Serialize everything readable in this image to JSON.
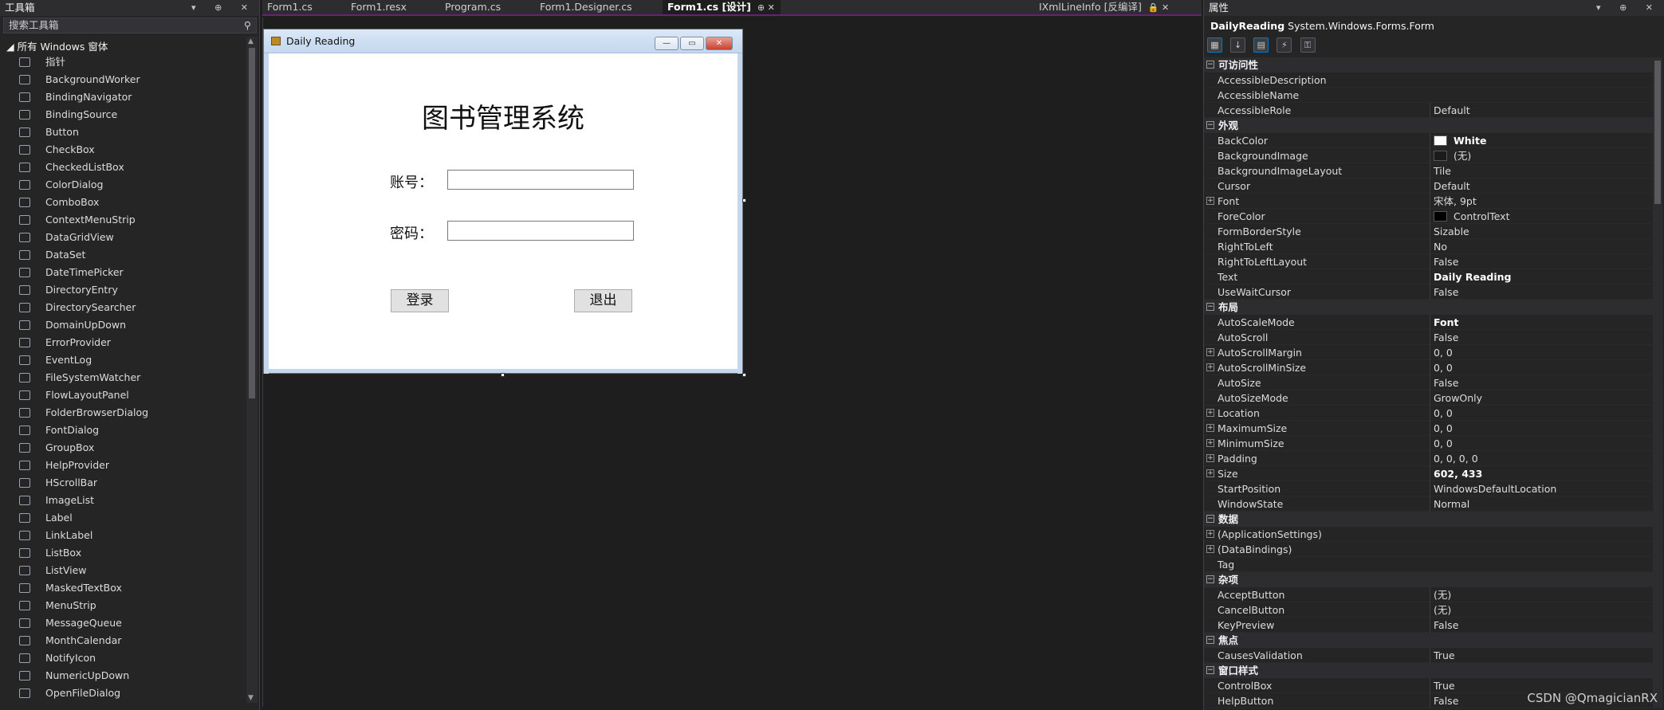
{
  "toolbox": {
    "title": "工具箱",
    "title_actions": "▾ ⊕ ✕",
    "search_placeholder": "搜索工具箱",
    "search_icon": "search-icon",
    "group_label": "◢ 所有 Windows 窗体",
    "items": [
      "指针",
      "BackgroundWorker",
      "BindingNavigator",
      "BindingSource",
      "Button",
      "CheckBox",
      "CheckedListBox",
      "ColorDialog",
      "ComboBox",
      "ContextMenuStrip",
      "DataGridView",
      "DataSet",
      "DateTimePicker",
      "DirectoryEntry",
      "DirectorySearcher",
      "DomainUpDown",
      "ErrorProvider",
      "EventLog",
      "FileSystemWatcher",
      "FlowLayoutPanel",
      "FolderBrowserDialog",
      "FontDialog",
      "GroupBox",
      "HelpProvider",
      "HScrollBar",
      "ImageList",
      "Label",
      "LinkLabel",
      "ListBox",
      "ListView",
      "MaskedTextBox",
      "MenuStrip",
      "MessageQueue",
      "MonthCalendar",
      "NotifyIcon",
      "NumericUpDown",
      "OpenFileDialog"
    ]
  },
  "tabs": [
    {
      "label": "Form1.cs",
      "active": false
    },
    {
      "label": "Form1.resx",
      "active": false
    },
    {
      "label": "Program.cs",
      "active": false
    },
    {
      "label": "Form1.Designer.cs",
      "active": false
    },
    {
      "label": "Form1.cs [设计]",
      "active": true,
      "suffix": "⊕ ✕"
    },
    {
      "label": "IXmlLineInfo [反编译]",
      "active": false,
      "suffix": "🔒 ✕"
    }
  ],
  "tabbar_actions": "▾ ⚙",
  "form": {
    "window_title": "Daily Reading",
    "system_title": "图书管理系统",
    "account_label": "账号：",
    "password_label": "密码：",
    "login_button": "登录",
    "exit_button": "退出",
    "minimize_glyph": "—",
    "maximize_glyph": "▭",
    "close_glyph": "✕"
  },
  "properties": {
    "title": "属性",
    "title_actions": "▾ ⊕ ✕",
    "object_name": "DailyReading",
    "object_type": "System.Windows.Forms.Form",
    "toolbar_icons": [
      "categorized-icon",
      "alphabetical-icon",
      "properties-icon",
      "events-icon",
      "property-pages-icon"
    ],
    "categories": [
      {
        "name": "可访问性",
        "rows": [
          {
            "name": "AccessibleDescription",
            "value": ""
          },
          {
            "name": "AccessibleName",
            "value": ""
          },
          {
            "name": "AccessibleRole",
            "value": "Default"
          }
        ]
      },
      {
        "name": "外观",
        "rows": [
          {
            "name": "BackColor",
            "value": "White",
            "swatch": "#ffffff",
            "bold": true
          },
          {
            "name": "BackgroundImage",
            "value": "(无)",
            "swatch": "#1b1b1b"
          },
          {
            "name": "BackgroundImageLayout",
            "value": "Tile"
          },
          {
            "name": "Cursor",
            "value": "Default"
          },
          {
            "name": "Font",
            "value": "宋体, 9pt",
            "expand": true
          },
          {
            "name": "ForeColor",
            "value": "ControlText",
            "swatch": "#000000"
          },
          {
            "name": "FormBorderStyle",
            "value": "Sizable"
          },
          {
            "name": "RightToLeft",
            "value": "No"
          },
          {
            "name": "RightToLeftLayout",
            "value": "False"
          },
          {
            "name": "Text",
            "value": "Daily Reading",
            "bold": true
          },
          {
            "name": "UseWaitCursor",
            "value": "False"
          }
        ]
      },
      {
        "name": "布局",
        "rows": [
          {
            "name": "AutoScaleMode",
            "value": "Font",
            "bold": true
          },
          {
            "name": "AutoScroll",
            "value": "False"
          },
          {
            "name": "AutoScrollMargin",
            "value": "0, 0",
            "expand": true
          },
          {
            "name": "AutoScrollMinSize",
            "value": "0, 0",
            "expand": true
          },
          {
            "name": "AutoSize",
            "value": "False"
          },
          {
            "name": "AutoSizeMode",
            "value": "GrowOnly"
          },
          {
            "name": "Location",
            "value": "0, 0",
            "expand": true
          },
          {
            "name": "MaximumSize",
            "value": "0, 0",
            "expand": true
          },
          {
            "name": "MinimumSize",
            "value": "0, 0",
            "expand": true
          },
          {
            "name": "Padding",
            "value": "0, 0, 0, 0",
            "expand": true
          },
          {
            "name": "Size",
            "value": "602, 433",
            "expand": true,
            "bold": true
          },
          {
            "name": "StartPosition",
            "value": "WindowsDefaultLocation"
          },
          {
            "name": "WindowState",
            "value": "Normal"
          }
        ]
      },
      {
        "name": "数据",
        "rows": [
          {
            "name": "(ApplicationSettings)",
            "value": "",
            "expand": true
          },
          {
            "name": "(DataBindings)",
            "value": "",
            "expand": true
          },
          {
            "name": "Tag",
            "value": ""
          }
        ]
      },
      {
        "name": "杂项",
        "rows": [
          {
            "name": "AcceptButton",
            "value": "(无)"
          },
          {
            "name": "CancelButton",
            "value": "(无)"
          },
          {
            "name": "KeyPreview",
            "value": "False"
          }
        ]
      },
      {
        "name": "焦点",
        "rows": [
          {
            "name": "CausesValidation",
            "value": "True"
          }
        ]
      },
      {
        "name": "窗口样式",
        "rows": [
          {
            "name": "ControlBox",
            "value": "True"
          },
          {
            "name": "HelpButton",
            "value": "False"
          }
        ]
      }
    ]
  },
  "watermark": "CSDN @QmagicianRX",
  "colors": {
    "accent": "#68217a",
    "panel": "#252526",
    "surface": "#1e1e1e",
    "selection": "#007acc"
  }
}
